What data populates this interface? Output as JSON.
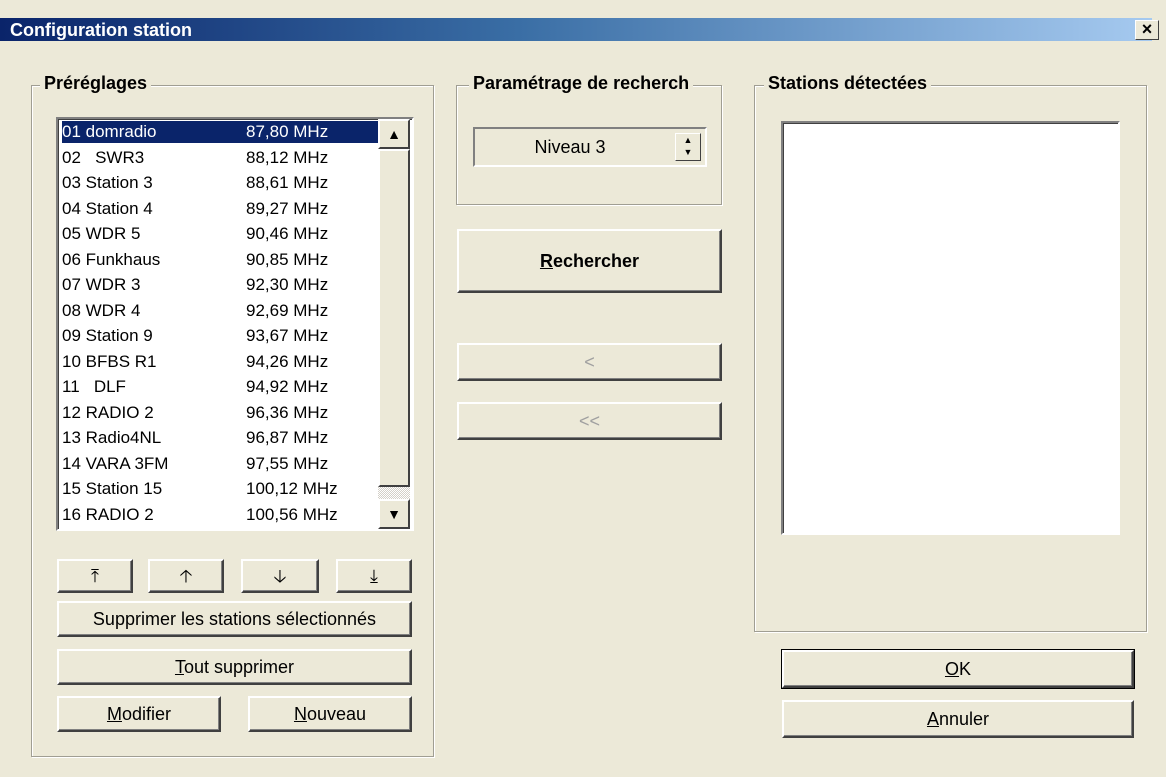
{
  "window": {
    "title": "Configuration station",
    "close_label": "×"
  },
  "presets": {
    "legend": "Préréglages",
    "items": [
      {
        "num": "01",
        "name": "domradio",
        "freq": "87,80 MHz",
        "selected": true
      },
      {
        "num": "02",
        "name": "  SWR3",
        "freq": "88,12 MHz"
      },
      {
        "num": "03",
        "name": "Station 3",
        "freq": "88,61 MHz"
      },
      {
        "num": "04",
        "name": "Station 4",
        "freq": "89,27 MHz"
      },
      {
        "num": "05",
        "name": "WDR 5",
        "freq": "90,46 MHz"
      },
      {
        "num": "06",
        "name": "Funkhaus",
        "freq": "90,85 MHz"
      },
      {
        "num": "07",
        "name": "WDR 3",
        "freq": "92,30 MHz"
      },
      {
        "num": "08",
        "name": "WDR 4",
        "freq": "92,69 MHz"
      },
      {
        "num": "09",
        "name": "Station 9",
        "freq": "93,67 MHz"
      },
      {
        "num": "10",
        "name": "BFBS R1",
        "freq": "94,26 MHz"
      },
      {
        "num": "11",
        "name": "  DLF",
        "freq": "94,92 MHz"
      },
      {
        "num": "12",
        "name": "RADIO 2",
        "freq": "96,36 MHz"
      },
      {
        "num": "13",
        "name": "Radio4NL",
        "freq": "96,87 MHz"
      },
      {
        "num": "14",
        "name": "VARA 3FM",
        "freq": "97,55 MHz"
      },
      {
        "num": "15",
        "name": "Station 15",
        "freq": "100,12 MHz"
      },
      {
        "num": "16",
        "name": "RADIO 2",
        "freq": "100,56 MHz"
      }
    ],
    "move_buttons": [
      "⤒",
      "🡡",
      "🡣",
      "⤓"
    ],
    "delete_selected_label": "Supprimer les stations sélectionnés",
    "delete_all_label": {
      "first": "T",
      "rest": "out supprimer"
    },
    "modify_label": {
      "first": "M",
      "rest": "odifier"
    },
    "new_label": {
      "first": "N",
      "rest": "ouveau"
    }
  },
  "search_settings": {
    "legend": "Paramétrage de recherch",
    "level_value": "Niveau 3",
    "search_label": {
      "first": "R",
      "rest": "echercher"
    },
    "transfer_one_label": "<",
    "transfer_all_label": "<<"
  },
  "detected": {
    "legend": "Stations détectées",
    "items": []
  },
  "dialog": {
    "ok_label": {
      "first": "O",
      "rest": "K"
    },
    "cancel_label": {
      "first": "A",
      "rest": "nnuler"
    }
  },
  "colors": {
    "selection": "#0a246a",
    "face": "#ece9d8",
    "title_start": "#0a246a",
    "title_end": "#a6caf0"
  }
}
